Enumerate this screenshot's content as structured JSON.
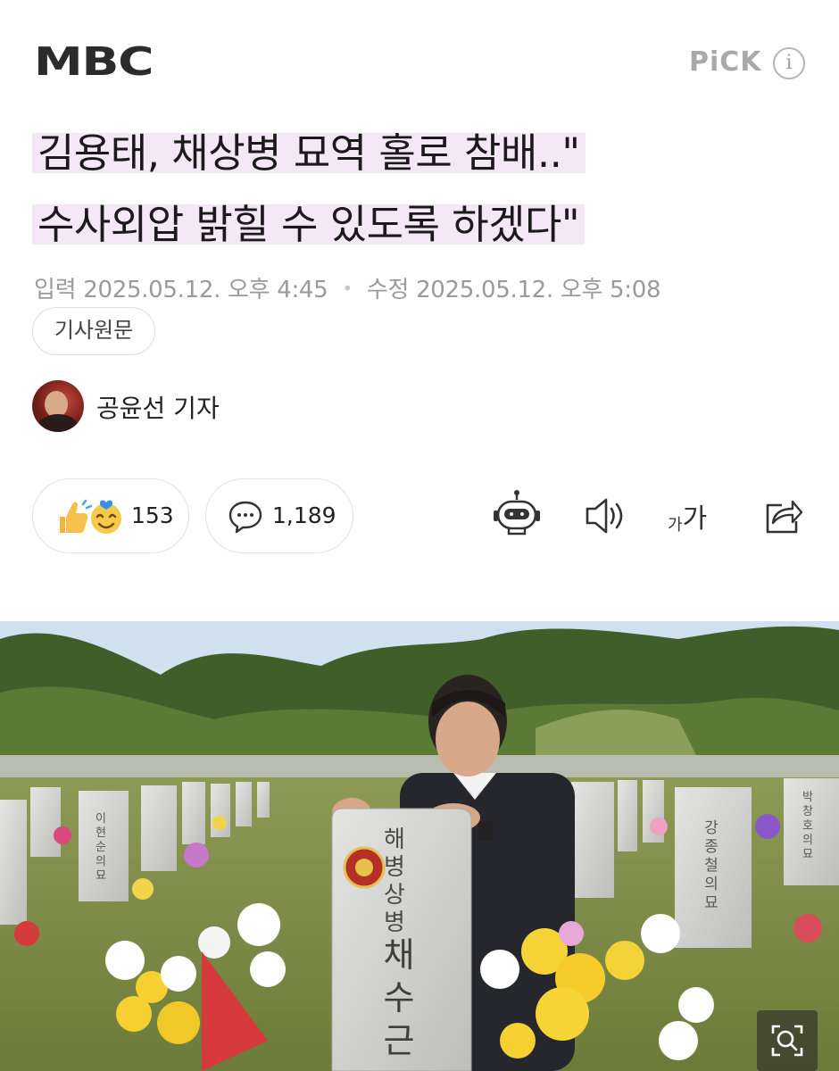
{
  "header": {
    "logo": "MBC",
    "pick_label": "PiCK",
    "info_glyph": "i"
  },
  "article": {
    "headline_line1": "김용태, 채상병 묘역 홀로 참배..\"",
    "headline_line2": "수사외압 밝힐 수 있도록 하겠다\"",
    "input_label": "입력",
    "input_time": "2025.05.12. 오후 4:45",
    "modified_label": "수정",
    "modified_time": "2025.05.12. 오후 5:08",
    "original_button": "기사원문",
    "author": "공윤선 기자"
  },
  "reactions": {
    "like_count": "153",
    "comment_count": "1,189"
  },
  "toolbar": {
    "font_size_small": "가",
    "font_size_large": "가"
  },
  "photo": {
    "tombstone_line1": "해병상병",
    "tombstone_line2": "채수근",
    "other_name_1": "이현순의묘",
    "other_name_2": "강종철의묘",
    "other_name_3": "박창호의묘"
  },
  "colors": {
    "headline_highlight": "#f4e8f6",
    "meta_text": "#9a9a9a",
    "logo": "#2b2b2b"
  }
}
